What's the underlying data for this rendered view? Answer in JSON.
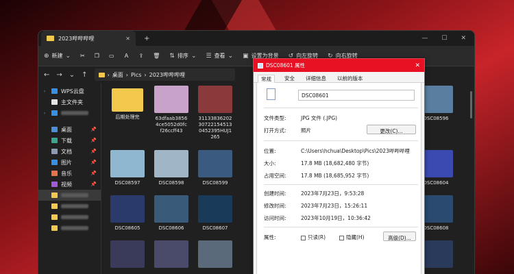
{
  "window": {
    "tab_title": "2023哔哔哔哩"
  },
  "toolbar": {
    "new": "新建",
    "sort": "排序",
    "view": "查看",
    "set_bg": "设置为背景",
    "rotate_left": "向左旋转",
    "rotate_right": "向右旋转"
  },
  "address": {
    "seg1": "桌面",
    "seg2": "Pics",
    "seg3": "2023哔哔哔哩"
  },
  "sidebar": [
    {
      "label": "WPS云盘",
      "icon": "cloud-icon",
      "color": "#3a8ee6"
    },
    {
      "label": "主文件夹",
      "icon": "home-icon",
      "color": "#e6e6e6"
    },
    {
      "label": "",
      "icon": "cloud-icon",
      "color": "#3a8ee6",
      "blurred": true
    },
    {
      "label": "桌面",
      "icon": "desktop-icon",
      "color": "#4c8fd6"
    },
    {
      "label": "下载",
      "icon": "download-icon",
      "color": "#3aa68d"
    },
    {
      "label": "文档",
      "icon": "document-icon",
      "color": "#8a9bb3"
    },
    {
      "label": "图片",
      "icon": "pictures-icon",
      "color": "#3a8ee6"
    },
    {
      "label": "音乐",
      "icon": "music-icon",
      "color": "#e6734c"
    },
    {
      "label": "视频",
      "icon": "video-icon",
      "color": "#a05ad6"
    }
  ],
  "files": [
    {
      "name": "后期处理完",
      "color": "#f2c94c"
    },
    {
      "name": "63dfaab38564ce5052d0fcf26ccff43",
      "color": "#c9a2c9"
    },
    {
      "name": "31133836202307221545130452395HUJ1265",
      "color": "#8a3a3a"
    },
    {
      "name": "DSC08596",
      "color": "#5a7ea0"
    },
    {
      "name": "DSC08597",
      "color": "#8fb8d0"
    },
    {
      "name": "DSC08598",
      "color": "#a0b6c6"
    },
    {
      "name": "DSC08599",
      "color": "#3a5a80"
    },
    {
      "name": "DSC08604",
      "color": "#3a4ab0"
    },
    {
      "name": "DSC08605",
      "color": "#2a3a6a"
    },
    {
      "name": "DSC08606",
      "color": "#3a5a7a"
    },
    {
      "name": "DSC08607",
      "color": "#1a3a5a"
    },
    {
      "name": "DSC08608",
      "color": "#2a4a70"
    },
    {
      "name": "",
      "color": "#3a3a5a"
    },
    {
      "name": "",
      "color": "#4a4a6a"
    },
    {
      "name": "",
      "color": "#5a6a7a"
    },
    {
      "name": "",
      "color": "#2a3a5a"
    }
  ],
  "dialog": {
    "title": "DSC08601 属性",
    "tabs": [
      "常规",
      "安全",
      "详细信息",
      "以前的版本"
    ],
    "name": "DSC08601",
    "type_k": "文件类型:",
    "type_v": "JPG 文件 (.JPG)",
    "open_k": "打开方式:",
    "open_v": "照片",
    "change_btn": "更改(C)...",
    "loc_k": "位置:",
    "loc_v": "C:\\Users\\hchua\\Desktop\\Pics\\2023哔哔哔哩",
    "size_k": "大小:",
    "size_v": "17.8 MB (18,682,480 字节)",
    "disk_k": "占用空间:",
    "disk_v": "17.8 MB (18,685,952 字节)",
    "created_k": "创建时间:",
    "created_v": "2023年7月23日，9:53:28",
    "modified_k": "修改时间:",
    "modified_v": "2023年7月23日，15:26:11",
    "accessed_k": "访问时间:",
    "accessed_v": "2023年10月19日，10:36:42",
    "attr_k": "属性:",
    "readonly": "只读(R)",
    "hidden": "隐藏(H)",
    "advanced_btn": "高级(D)..."
  }
}
